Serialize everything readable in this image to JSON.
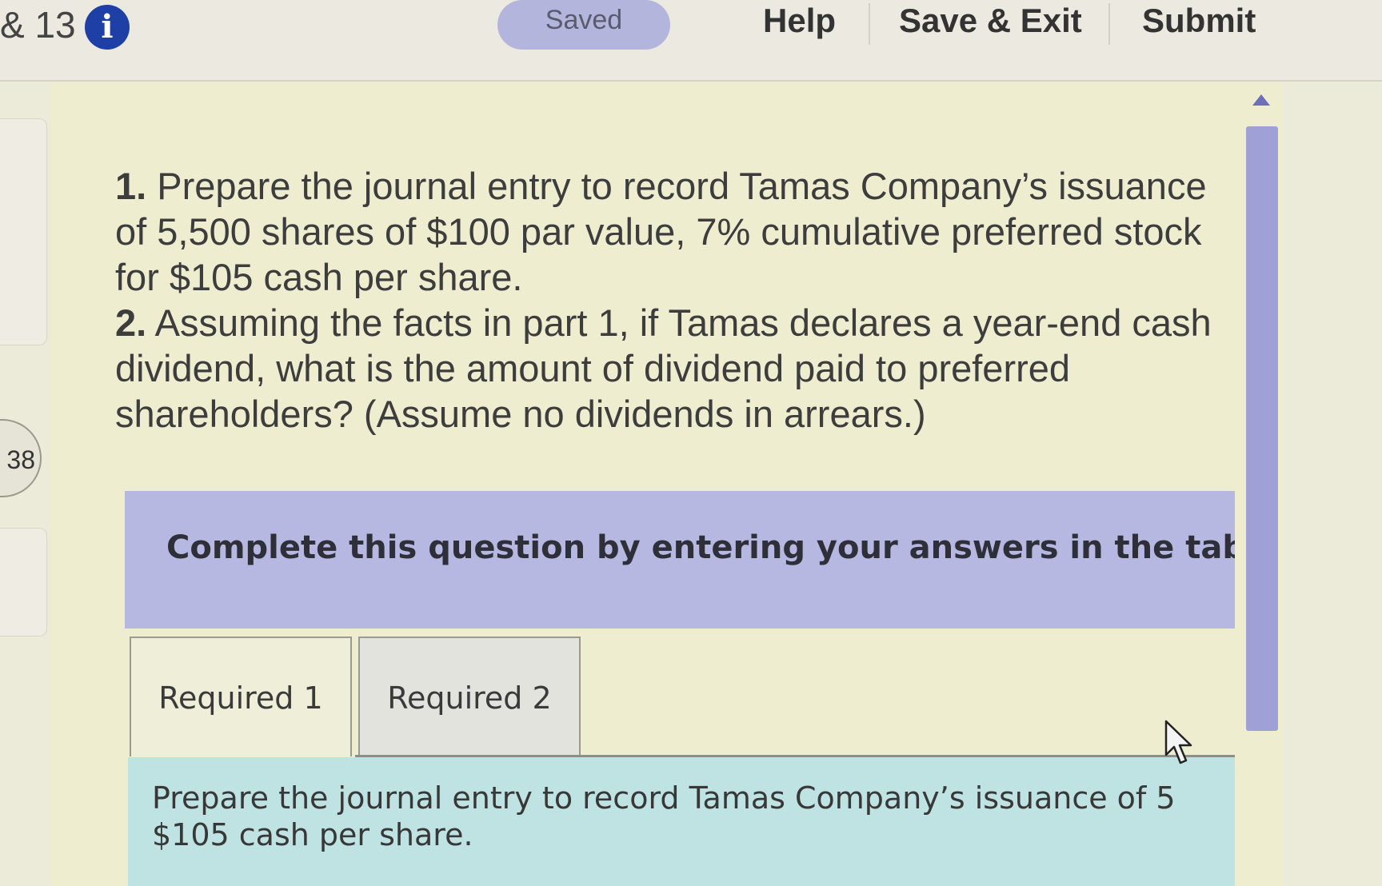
{
  "header": {
    "question_range": "& 13",
    "saved_label": "Saved",
    "help_label": "Help",
    "save_exit_label": "Save & Exit",
    "submit_label": "Submit"
  },
  "rail": {
    "question_number": "38"
  },
  "question": {
    "part1_num": "1.",
    "part1_text": " Prepare the journal entry to record Tamas Company’s issuance of 5,500 shares of $100 par value, 7% cumulative preferred stock for $105 cash per share.",
    "part2_num": "2.",
    "part2_text": " Assuming the facts in part 1, if Tamas declares a year-end cash dividend, what is the amount of dividend paid to preferred shareholders? (Assume no dividends in arrears.)"
  },
  "instruction": "Complete this question by entering your answers in the tab",
  "tabs": [
    {
      "label": "Required 1"
    },
    {
      "label": "Required 2"
    }
  ],
  "tab_content": {
    "line1": "Prepare the journal entry to record Tamas Company’s issuance of 5",
    "line2": "$105 cash per share."
  },
  "colors": {
    "accent_blue": "#1d3fa6",
    "instruction_bg": "#b6b8e2",
    "tab_content_bg": "#bfe3e3"
  }
}
